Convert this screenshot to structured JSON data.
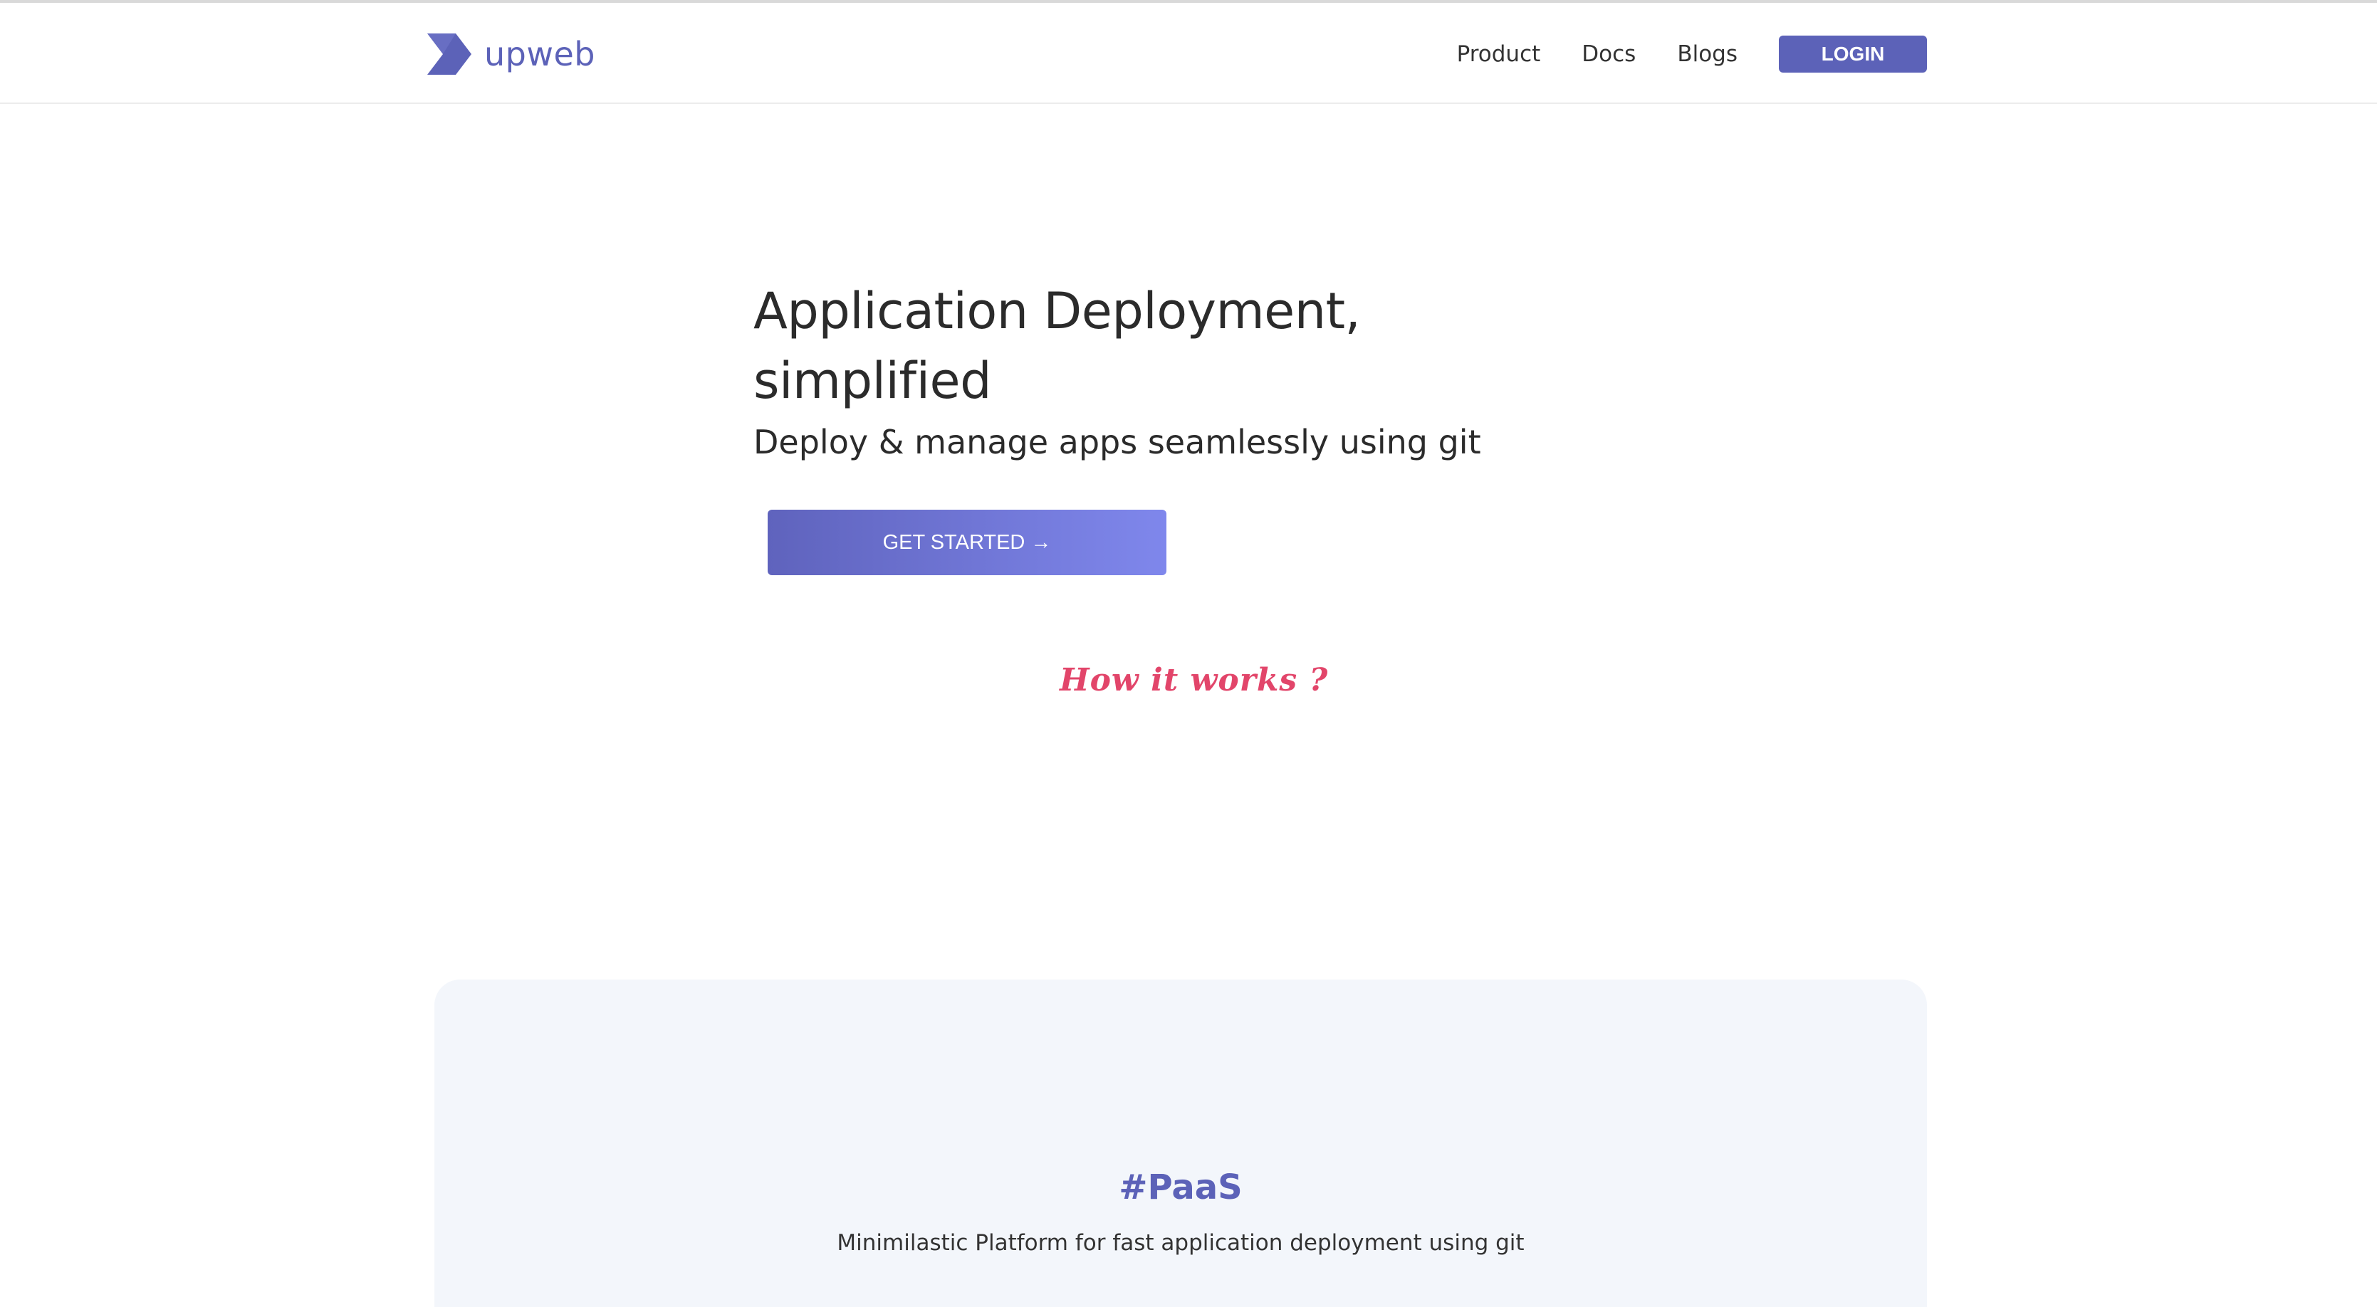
{
  "brand": {
    "name": "upweb",
    "logo_icon": "upweb-chevron-logo",
    "color": "#5c62b8"
  },
  "nav": {
    "items": [
      {
        "label": "Product"
      },
      {
        "label": "Docs"
      },
      {
        "label": "Blogs"
      }
    ],
    "login_label": "LOGIN"
  },
  "hero": {
    "title": "Application Deployment, simplified",
    "subtitle": "Deploy & manage apps seamlessly using git",
    "cta_label": "GET STARTED →",
    "how_it_works": "How it works ?",
    "cta_gradient": [
      "#5f63bd",
      "#7f87ec"
    ],
    "accent_color": "#e2456a"
  },
  "feature": {
    "title": "#PaaS",
    "description": "Minimilastic Platform for fast application deployment using git",
    "background": "#f3f6fb"
  }
}
